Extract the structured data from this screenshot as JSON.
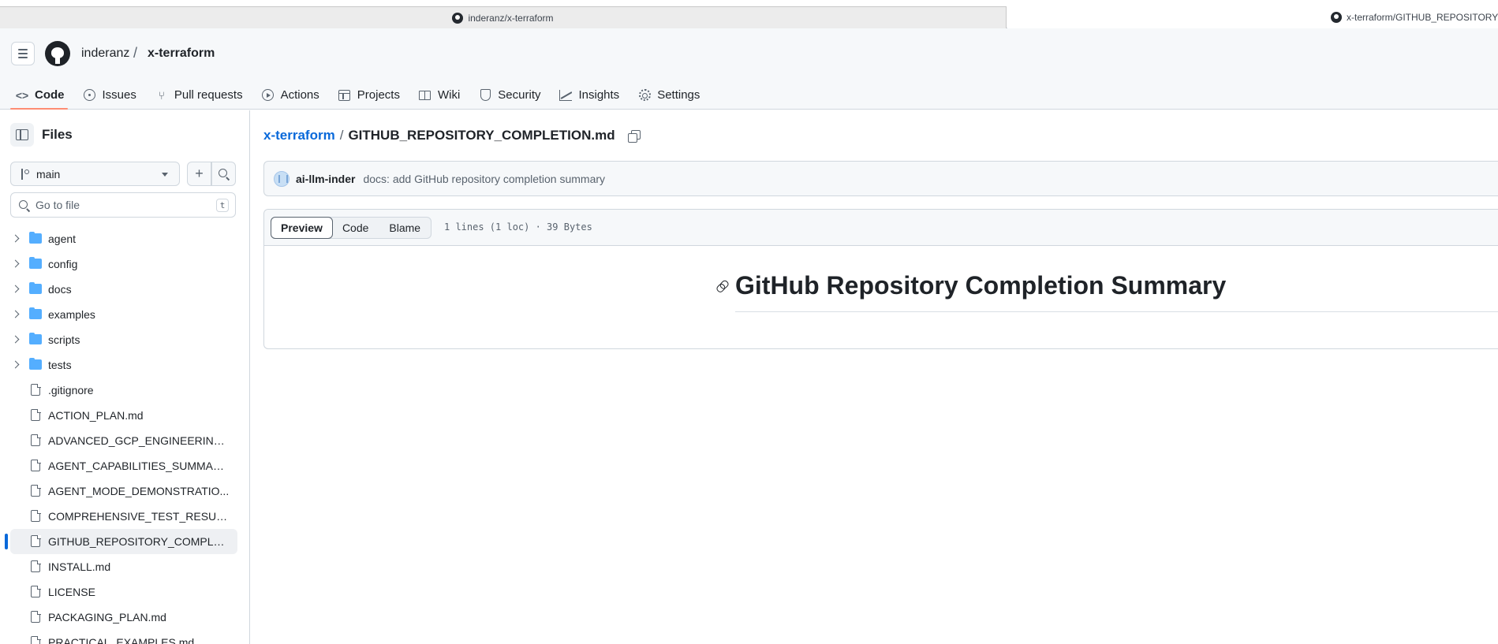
{
  "browser": {
    "tabs": [
      {
        "title": "inderanz/x-terraform",
        "active": false
      },
      {
        "title": "x-terraform/GITHUB_REPOSITORY_C",
        "active": true
      }
    ]
  },
  "header": {
    "owner": "inderanz",
    "separator": "/",
    "repo": "x-terraform"
  },
  "repo_nav": [
    {
      "label": "Code",
      "icon": "code-icon",
      "selected": true
    },
    {
      "label": "Issues",
      "icon": "issue-icon"
    },
    {
      "label": "Pull requests",
      "icon": "pull-request-icon"
    },
    {
      "label": "Actions",
      "icon": "play-icon"
    },
    {
      "label": "Projects",
      "icon": "table-icon"
    },
    {
      "label": "Wiki",
      "icon": "book-icon"
    },
    {
      "label": "Security",
      "icon": "shield-icon"
    },
    {
      "label": "Insights",
      "icon": "graph-icon"
    },
    {
      "label": "Settings",
      "icon": "gear-icon"
    }
  ],
  "sidebar": {
    "title": "Files",
    "branch": "main",
    "goto_placeholder": "Go to file",
    "goto_shortcut": "t",
    "tree": [
      {
        "type": "folder",
        "name": "agent"
      },
      {
        "type": "folder",
        "name": "config"
      },
      {
        "type": "folder",
        "name": "docs"
      },
      {
        "type": "folder",
        "name": "examples"
      },
      {
        "type": "folder",
        "name": "scripts"
      },
      {
        "type": "folder",
        "name": "tests"
      },
      {
        "type": "file",
        "name": ".gitignore"
      },
      {
        "type": "file",
        "name": "ACTION_PLAN.md"
      },
      {
        "type": "file",
        "name": "ADVANCED_GCP_ENGINEERING_..."
      },
      {
        "type": "file",
        "name": "AGENT_CAPABILITIES_SUMMARY..."
      },
      {
        "type": "file",
        "name": "AGENT_MODE_DEMONSTRATIO..."
      },
      {
        "type": "file",
        "name": "COMPREHENSIVE_TEST_RESULT..."
      },
      {
        "type": "file",
        "name": "GITHUB_REPOSITORY_COMPLET...",
        "selected": true
      },
      {
        "type": "file",
        "name": "INSTALL.md"
      },
      {
        "type": "file",
        "name": "LICENSE"
      },
      {
        "type": "file",
        "name": "PACKAGING_PLAN.md"
      },
      {
        "type": "file",
        "name": "PRACTICAL_EXAMPLES.md"
      }
    ]
  },
  "main": {
    "breadcrumb": {
      "repo": "x-terraform",
      "separator": "/",
      "file": "GITHUB_REPOSITORY_COMPLETION.md"
    },
    "commit": {
      "author": "ai-llm-inder",
      "message": "docs: add GitHub repository completion summary"
    },
    "file_view": {
      "tabs": [
        "Preview",
        "Code",
        "Blame"
      ],
      "active_tab": "Preview",
      "meta": "1 lines (1 loc) · 39 Bytes"
    },
    "markdown": {
      "heading": "GitHub Repository Completion Summary"
    }
  },
  "colors": {
    "accent": "#0969da",
    "nav_underline": "#fd8c73",
    "folder": "#54aeff"
  }
}
